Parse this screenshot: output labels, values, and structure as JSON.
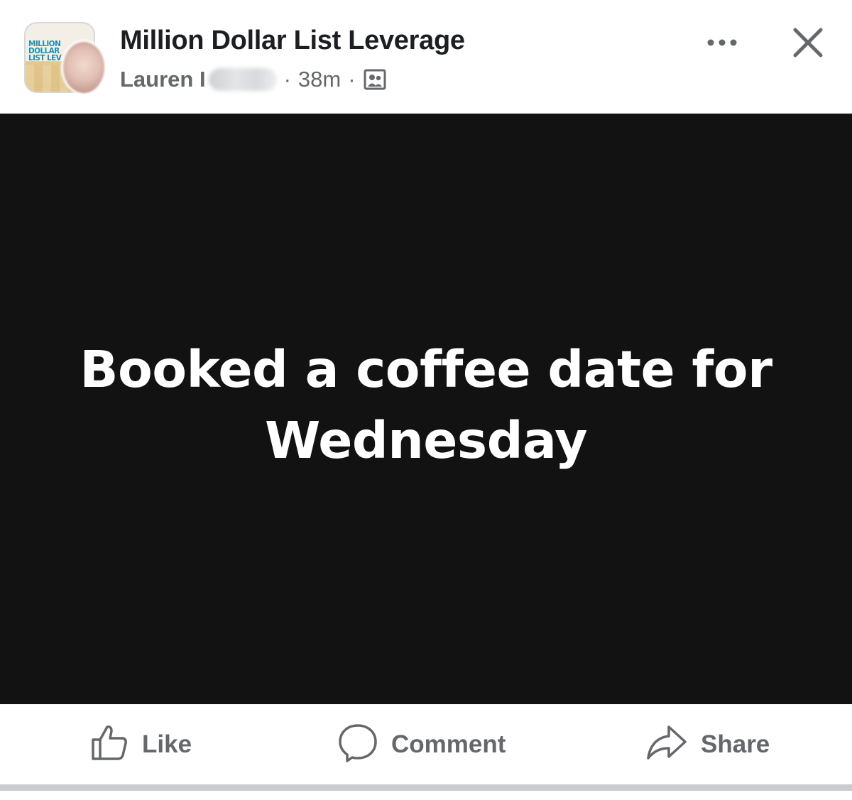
{
  "post": {
    "group_name": "Million Dollar List Leverage",
    "group_logo_text": "MILLION DOLLAR\nLIST LEV",
    "author_visible": "Lauren I",
    "time": "38m",
    "separator": "·",
    "audience_icon": "group-members-icon",
    "image_text": "Booked a coffee date for Wednesday",
    "image_background": "#121212",
    "image_text_color": "#ffffff"
  },
  "header_actions": {
    "more_icon": "more-horizontal-icon",
    "close_icon": "close-icon"
  },
  "actions": {
    "like": "Like",
    "comment": "Comment",
    "share": "Share",
    "like_icon": "thumbs-up-icon",
    "comment_icon": "comment-bubble-icon",
    "share_icon": "share-arrow-icon"
  },
  "colors": {
    "primary_text": "#1c1e21",
    "secondary_text": "#65676b",
    "divider": "#cbcccf"
  }
}
